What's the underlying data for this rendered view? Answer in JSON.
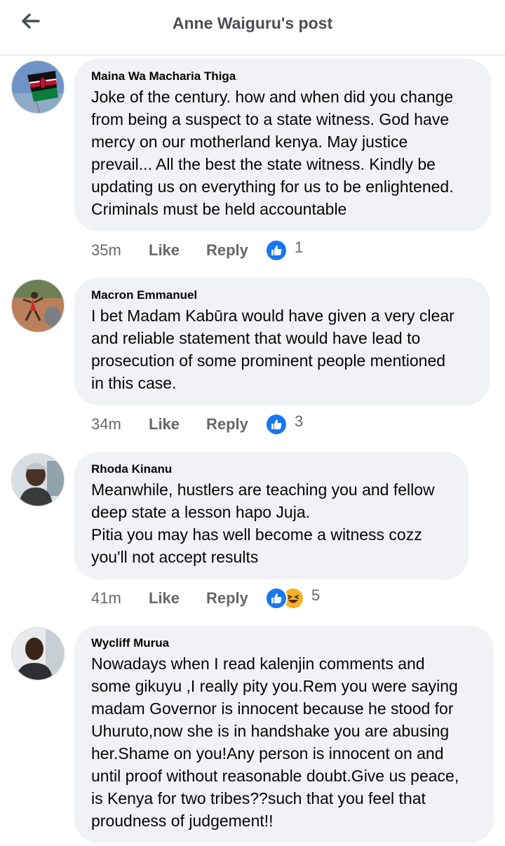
{
  "header": {
    "title": "Anne Waiguru's post"
  },
  "comments": [
    {
      "author": "Maina Wa Macharia Thiga",
      "lines": [
        "Joke of the century. how and when did you change",
        "from being a suspect to a state witness. God have",
        "mercy on our motherland kenya. May justice",
        "prevail... All the best the state witness. Kindly be",
        "updating us on everything  for us to be enlightened.",
        "Criminals must be held accountable"
      ],
      "time": "35m",
      "like": "Like",
      "reply": "Reply",
      "reaction_count": "1"
    },
    {
      "author": "Macron Emmanuel",
      "lines": [
        "I bet Madam Kabūra would have given a very clear",
        "and reliable statement that would have lead to",
        "prosecution of some prominent  people mentioned",
        "in this case."
      ],
      "time": "34m",
      "like": "Like",
      "reply": "Reply",
      "reaction_count": "3"
    },
    {
      "author": "Rhoda Kinanu",
      "lines": [
        "Meanwhile, hustlers are teaching you and fellow",
        "deep state a lesson hapo Juja.",
        "Pitia you may has well become a witness cozz",
        "you'll not accept results"
      ],
      "time": "41m",
      "like": "Like",
      "reply": "Reply",
      "reaction_count": "5"
    },
    {
      "author": "Wycliff Murua",
      "lines": [
        "Nowadays when I read kalenjin comments and",
        "some gikuyu ,I really pity you.Rem you were saying",
        "madam Governor is innocent because he stood for",
        "Uhuruto,now she is in handshake you are abusing",
        "her.Shame on you!Any person is innocent on and",
        "until proof without reasonable doubt.Give us peace,",
        "is Kenya for two tribes??such that you feel that",
        "proudness of judgement!!"
      ]
    }
  ],
  "icons": {
    "back": "arrow-left-icon",
    "like_reaction": "thumbs-up-icon",
    "haha_reaction": "laughing-face-icon"
  },
  "colors": {
    "like_blue": "#1877f2",
    "bubble_bg": "#f0f2f5",
    "meta_gray": "#65676b"
  }
}
